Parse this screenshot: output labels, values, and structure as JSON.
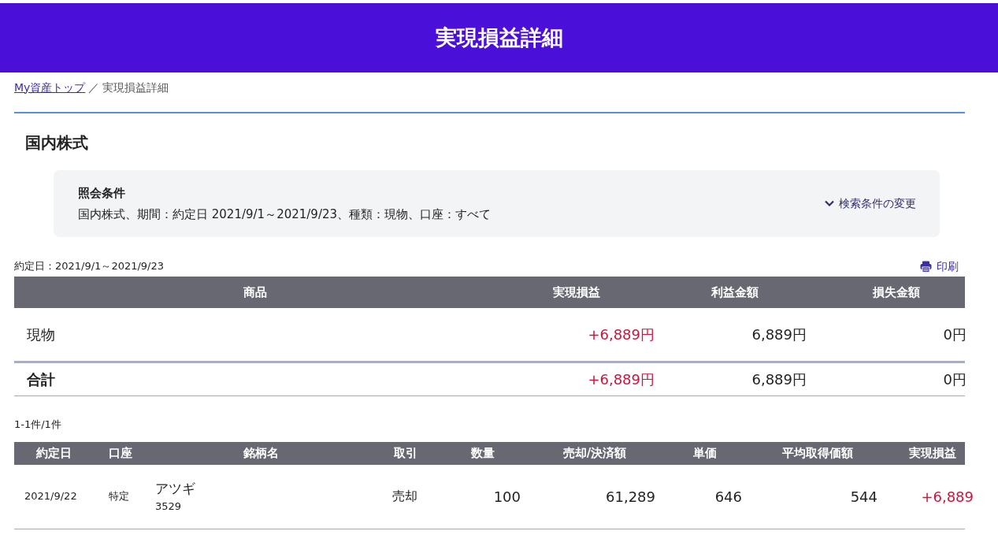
{
  "header": {
    "title": "実現損益詳細"
  },
  "breadcrumb": [
    {
      "label": "My資産トップ",
      "link": true
    },
    {
      "label": "／",
      "link": false
    },
    {
      "label": "実現損益詳細",
      "link": false
    }
  ],
  "section_title": "国内株式",
  "conditions": {
    "heading": "照会条件",
    "text": "国内株式、期間：約定日 2021/9/1～2021/9/23、種類：現物、口座：すべて",
    "change_link": "検索条件の変更"
  },
  "period": "約定日：2021/9/1～2021/9/23",
  "print_link": "印刷",
  "summary": {
    "columns": [
      "商品",
      "実現損益",
      "利益金額",
      "損失金額"
    ],
    "rows": [
      {
        "kind": "item",
        "cells": [
          "現物",
          "+6,889円",
          "6,889円",
          "0円"
        ],
        "gain": true
      },
      {
        "kind": "total",
        "cells": [
          "合計",
          "+6,889円",
          "6,889円",
          "0円"
        ],
        "gain": true
      }
    ]
  },
  "count": "1-1件/1件",
  "detail": {
    "columns": [
      "約定日",
      "口座",
      "銘柄名",
      "取引",
      "数量",
      "売却/決済額",
      "単価",
      "平均取得価額",
      "実現損益"
    ],
    "rows": [
      {
        "date": "2021/9/22",
        "account": "特定",
        "name": "アツギ",
        "code": "3529",
        "trade": "売却",
        "quantity": "100",
        "amount": "61,289",
        "price": "646",
        "avg_cost": "544",
        "pnl": "+6,889",
        "gain": true
      }
    ]
  }
}
